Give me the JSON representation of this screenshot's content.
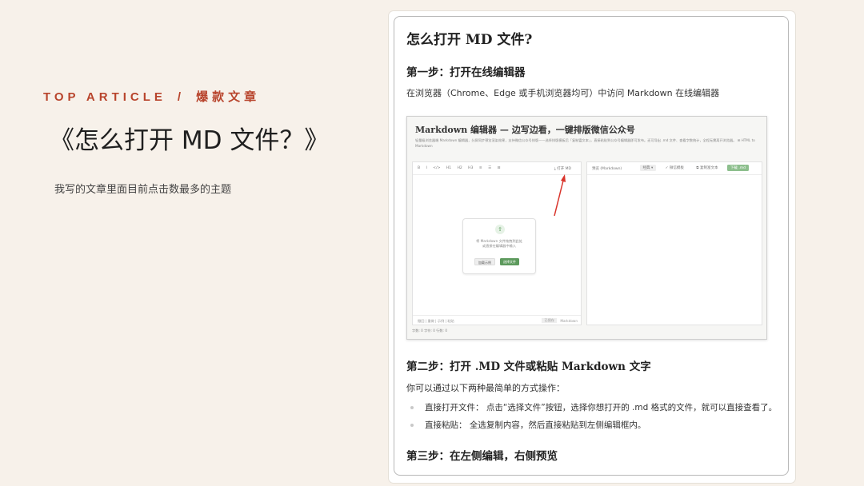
{
  "slide": {
    "kicker_en": "TOP ARTICLE",
    "kicker_sep": "/",
    "kicker_zh": "爆款文章",
    "title": "《怎么打开 MD 文件？》",
    "subtitle": "我写的文章里面目前点击数最多的主题"
  },
  "doc": {
    "h1": "怎么打开 MD 文件?",
    "step1_heading": "第一步：打开在线编辑器",
    "step1_text": "在浏览器（Chrome、Edge 或手机浏览器均可）中访问 Markdown 在线编辑器",
    "step2_heading": "第二步：打开 .MD 文件或粘贴 Markdown 文字",
    "step2_intro": "你可以通过以下两种最简单的方式操作：",
    "list": [
      "直接打开文件：   点击“选择文件”按钮，选择你想打开的 .md 格式的文件，就可以直接查看了。",
      "直接粘贴：   全选复制内容，然后直接粘贴到左侧编辑框内。"
    ],
    "step3_heading": "第三步：在左侧编辑，右侧预览"
  },
  "editor": {
    "title": "Markdown 编辑器 — 边写边看，一键排版微信公众号",
    "desc": "轻量级浏览器端 Markdown 编辑器，分屏同步预览渲染效果，支持微信公众号排版——选择排版模板后「复制富文本」，直接粘贴到公众号编辑器即可发布。还可导出 .md 文件、查看字数统计，全程无需离开浏览器。   ⊞ HTML to Markdown",
    "left_toolbar": [
      "B",
      "I",
      "</>",
      "H1",
      "H2",
      "H3",
      "≡",
      "☰",
      "⊟"
    ],
    "open_md": "⤓ 打开 MD",
    "upload_icon": "⇪",
    "upload_text_1": "将 Markdown 文件拖拽到此处",
    "upload_text_2": "或直接在编辑器中输入",
    "btn_sample": "加载示例",
    "btn_choose": "选择文件",
    "left_footer": "撤回 | 重做 | 示例 | 粘贴",
    "left_footer_right": "Markdown",
    "left_footer_badge": "已保存",
    "preview_label": "预览 (Markdown)",
    "preview_buttons": [
      "经典 ▾",
      "✓ 微信模板",
      "⧉ 复制富文本",
      "下载 .md"
    ],
    "status": "字数: 0   字符: 0   行数: 0",
    "colors": {
      "accent": "#5d9a5d",
      "arrow": "#d9342b"
    }
  }
}
